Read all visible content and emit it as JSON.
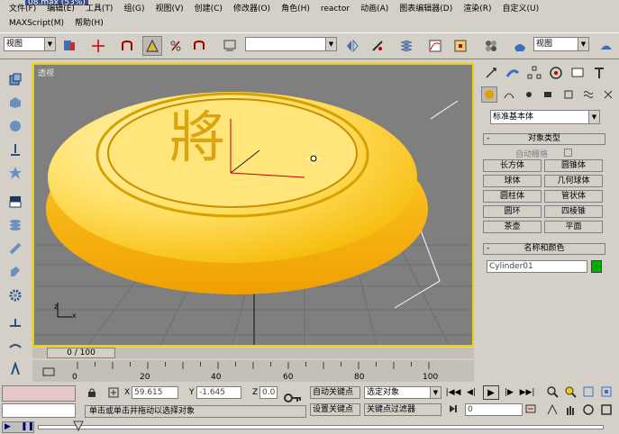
{
  "title_fragment": "08.max (53%)",
  "menu": {
    "row1": [
      "文件(F)",
      "编辑(E)",
      "工具(T)",
      "组(G)",
      "视图(V)",
      "创建(C)",
      "修改器(O)",
      "角色(H)",
      "reactor",
      "动画(A)",
      "图表编辑器(D)",
      "渲染(R)",
      "自定义(U)"
    ],
    "row2": [
      "MAXScript(M)",
      "帮助(H)"
    ]
  },
  "toolbar": {
    "selection_filter": "视图",
    "named_selection": "",
    "ref_coord": "视图"
  },
  "viewport": {
    "label": "透视",
    "chess_glyph": "將",
    "axis_z": "z",
    "axis_x": "x"
  },
  "command_panel": {
    "category": "标准基本体",
    "section_object_type": "对象类型",
    "autogrid": "自动栅格",
    "objects": [
      "长方体",
      "圆锥体",
      "球体",
      "几何球体",
      "圆柱体",
      "管状体",
      "圆环",
      "四棱锥",
      "茶壶",
      "平面"
    ],
    "section_name_color": "名称和颜色",
    "object_name": "Cylinder01",
    "object_color": "#00b000"
  },
  "timeline": {
    "slider": "0 / 100",
    "ticks": [
      "0",
      "20",
      "40",
      "60",
      "80",
      "100"
    ]
  },
  "status": {
    "x_label": "X",
    "x_value": "59.615",
    "y_label": "Y",
    "y_value": "-1.645",
    "z_label": "Z",
    "z_value": "0.0",
    "auto_key": "自动关键点",
    "set_key": "设置关键点",
    "selected_set": "选定对象",
    "key_filters": "关键点过滤器",
    "frame": "0",
    "prompt": "单击或单击并拖动以选择对象"
  }
}
